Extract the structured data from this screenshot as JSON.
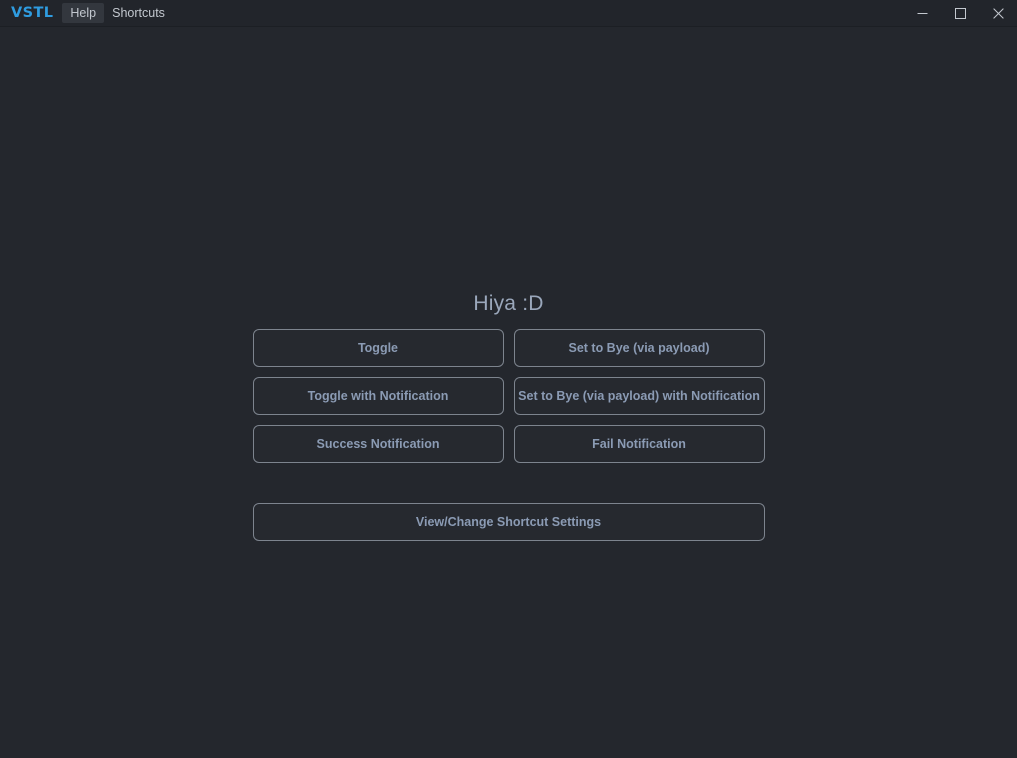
{
  "titlebar": {
    "logo": "VSTL",
    "menu": [
      {
        "label": "Help",
        "state": "active"
      },
      {
        "label": "Shortcuts",
        "state": "normal"
      }
    ],
    "window_controls": [
      {
        "name": "minimize",
        "glyph": "–"
      },
      {
        "name": "maximize",
        "glyph": "□"
      },
      {
        "name": "close",
        "glyph": "✕"
      }
    ]
  },
  "main": {
    "heading": "Hiya :D",
    "buttons": [
      {
        "label": "Toggle"
      },
      {
        "label": "Set to Bye (via payload)"
      },
      {
        "label": "Toggle with Notification"
      },
      {
        "label": "Set to Bye (via payload) with Notification"
      },
      {
        "label": "Success Notification"
      },
      {
        "label": "Fail Notification"
      }
    ],
    "footer_button": {
      "label": "View/Change Shortcut Settings"
    }
  },
  "colors": {
    "background": "#24272d",
    "titlebar": "#22252b",
    "logo_blue": "#2f9ce0",
    "button_border": "#7d848e",
    "button_text": "#8b9bb4",
    "heading_text": "#9aa7bb",
    "menu_text": "#c3c8cf",
    "menu_active_bg": "#33373e"
  }
}
